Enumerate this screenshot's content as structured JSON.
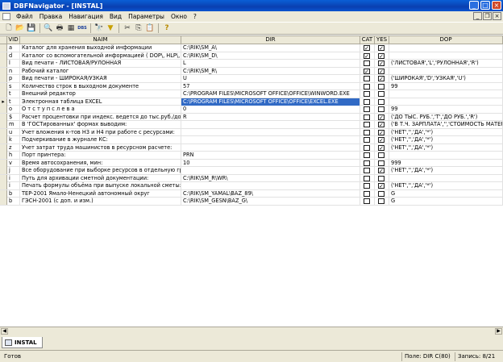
{
  "window": {
    "title": "DBFNavigator - [INSTAL]"
  },
  "menu": {
    "items": [
      "Файл",
      "Правка",
      "Навигация",
      "Вид",
      "Параметры",
      "Окно",
      "?"
    ]
  },
  "toolbar": {
    "icons": [
      "new-file-icon",
      "open-folder-icon",
      "save-icon",
      "print-preview-icon",
      "print-icon",
      "setup-icon",
      "dbs-icon",
      "find-icon",
      "filter-icon",
      "cut-icon",
      "copy-icon",
      "paste-icon",
      "help-icon"
    ],
    "dbs_label": "DBS"
  },
  "grid": {
    "columns": {
      "vid": "VID",
      "naim": "NAIM",
      "dir": "DIR",
      "cat": "CAT",
      "yes": "YES",
      "dop": "DOP"
    },
    "rows": [
      {
        "vid": "a",
        "naim": "Каталог для хранения выходной информации",
        "dir": "C:\\RIK\\SM_A\\",
        "cat": true,
        "yes": true,
        "dop": ""
      },
      {
        "vid": "d",
        "naim": "Каталог со вспомогательной информацией ( DOP\\, HLP\\, ...)",
        "dir": "C:\\RIK\\SM_D\\",
        "cat": true,
        "yes": true,
        "dop": ""
      },
      {
        "vid": "l",
        "naim": "Вид печати - ЛИСТОВАЯ/РУЛОННАЯ",
        "dir": "L",
        "cat": false,
        "yes": true,
        "dop": "('ЛИСТОВАЯ','L','РУЛОННАЯ','R')"
      },
      {
        "vid": "n",
        "naim": "Рабочий каталог",
        "dir": "C:\\RIK\\SM_R\\",
        "cat": true,
        "yes": true,
        "dop": ""
      },
      {
        "vid": "p",
        "naim": "Вид печати - ШИРОКАЯ/УЗКАЯ",
        "dir": "U",
        "cat": false,
        "yes": true,
        "dop": "('ШИРОКАЯ','D','УЗКАЯ','U')"
      },
      {
        "vid": "s",
        "naim": "Количество строк в выходном документе",
        "dir": "57",
        "cat": false,
        "yes": false,
        "dop": "99"
      },
      {
        "vid": "t",
        "naim": "      Внешний  редактор",
        "dir": "C:\\PROGRAM FILES\\MICROSOFT OFFICE\\OFFICE\\WINWORD.EXE",
        "cat": false,
        "yes": false,
        "dop": ""
      },
      {
        "vid": "t",
        "naim": "Электронная таблица EXCEL",
        "dir": "C:\\PROGRAM FILES\\MICROSOFT OFFICE\\OFFICE\\EXCEL.EXE",
        "cat": false,
        "yes": false,
        "dop": "",
        "selected": true
      },
      {
        "vid": "o",
        "naim": "      О т с т у п   с л е в а",
        "dir": "0",
        "cat": false,
        "yes": false,
        "dop": "99"
      },
      {
        "vid": "$",
        "naim": "Расчет процентовки при индекс. ведется до тыс.руб./до руб",
        "dir": "R",
        "cat": false,
        "yes": true,
        "dop": "('ДО ТЫС. РУБ.','T','ДО РУБ.','R')"
      },
      {
        "vid": "m",
        "naim": "В 'ГОСТированных' формах выводим:",
        "dir": "",
        "cat": false,
        "yes": true,
        "dop": "('В Т.Ч. ЗАРПЛАТА','','СТОИМОСТЬ МАТЕРИ"
      },
      {
        "vid": "u",
        "naim": "Учет вложения к-тов Н3 и Н4 при работе с ресурсами:",
        "dir": "",
        "cat": false,
        "yes": true,
        "dop": "('НЕТ','','ДА','*')"
      },
      {
        "vid": "k",
        "naim": "Подчеркивание в журнале КС:",
        "dir": "",
        "cat": false,
        "yes": true,
        "dop": "('НЕТ','','ДА','*')"
      },
      {
        "vid": "z",
        "naim": "Учет затрат труда машинистов в ресурсном расчете:",
        "dir": "",
        "cat": false,
        "yes": true,
        "dop": "('НЕТ','','ДА','*')"
      },
      {
        "vid": "h",
        "naim": "Порт принтера:",
        "dir": "PRN",
        "cat": false,
        "yes": false,
        "dop": ""
      },
      {
        "vid": "v",
        "naim": "Время автосохранения, мин:",
        "dir": "10",
        "cat": false,
        "yes": false,
        "dop": "999"
      },
      {
        "vid": "j",
        "naim": "Все оборудование при выборке ресурсов в отдельную группу",
        "dir": "",
        "cat": false,
        "yes": true,
        "dop": "('НЕТ','','ДА','*')"
      },
      {
        "vid": "i",
        "naim": "Путь для архивации сметной документации:",
        "dir": "C:\\RIK\\SM_R\\WR\\",
        "cat": false,
        "yes": false,
        "dop": ""
      },
      {
        "vid": "i",
        "naim": "Печать формулы объёма при выпуске локальной сметы:",
        "dir": "",
        "cat": false,
        "yes": true,
        "dop": "('НЕТ','','ДА','*')"
      },
      {
        "vid": "b",
        "naim": "ТЕР-2001 Ямало-Ненецкий автономный округ",
        "dir": "C:\\RIK\\SM_YAMAL\\BAZ_89\\",
        "cat": false,
        "yes": false,
        "dop": "G"
      },
      {
        "vid": "b",
        "naim": "ГЭСН-2001 (с доп. и изм.)",
        "dir": "C:\\RIK\\SM_GESN\\BAZ_G\\",
        "cat": false,
        "yes": false,
        "dop": "G"
      }
    ]
  },
  "tabs": [
    {
      "label": "INSTAL"
    }
  ],
  "status": {
    "ready": "Готов",
    "field": "Поле: DIR C(80)",
    "record": "Запись: 8/21"
  }
}
